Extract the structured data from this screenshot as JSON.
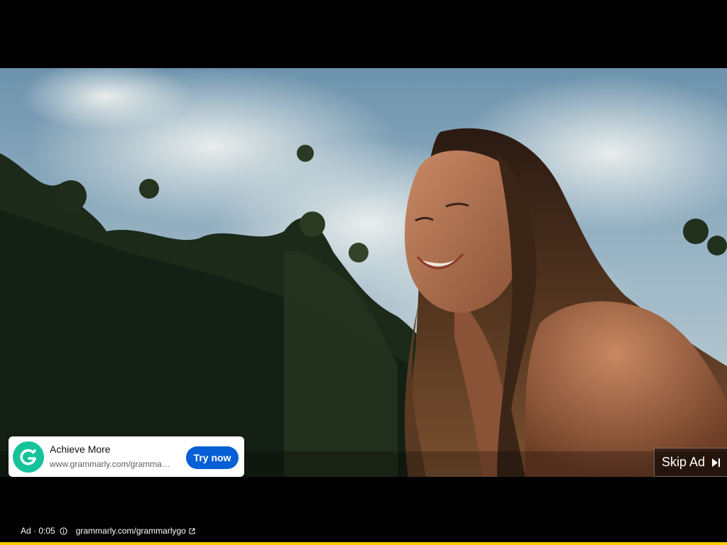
{
  "ad_card": {
    "title": "Achieve More",
    "url": "www.grammarly.com/grammarlygo",
    "cta_label": "Try now",
    "logo_icon": "grammarly-logo-icon",
    "brand_color": "#15c39a",
    "cta_color": "#065fd4"
  },
  "skip": {
    "label": "Skip Ad",
    "icon": "skip-next-icon"
  },
  "ad_info": {
    "badge": "Ad · 0:05",
    "advertiser_link": "grammarly.com/grammarlygo",
    "info_icon": "info-icon",
    "external_icon": "external-link-icon"
  },
  "progress": {
    "fraction": 1.0,
    "color": "#ffcc00"
  }
}
